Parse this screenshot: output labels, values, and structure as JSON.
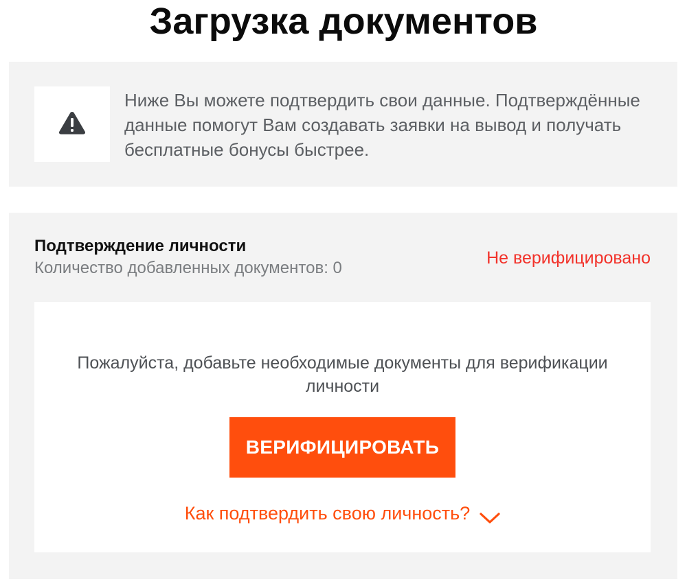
{
  "page": {
    "title": "Загрузка документов"
  },
  "notice": {
    "icon": "warning-icon",
    "text": "Ниже Вы можете подтвердить свои данные. Подтверждённые данные помогут Вам создавать заявки на вывод и получать бесплатные бонусы быстрее."
  },
  "identity": {
    "title": "Подтверждение личности",
    "documents_count_text": "Количество добавленных документов: 0",
    "status": "Не верифицировано",
    "message": "Пожалуйста, добавьте необходимые документы для верификации личности",
    "verify_button_label": "ВЕРИФИЦИРОВАТЬ",
    "how_to_link": "Как подтвердить свою личность?",
    "how_to_icon": "chevron-down-icon"
  },
  "colors": {
    "accent": "#ff4e0d",
    "status_error": "#f2322a",
    "panel_background": "#f3f3f3",
    "card_background": "#ffffff",
    "icon_color": "#3b3e42"
  }
}
